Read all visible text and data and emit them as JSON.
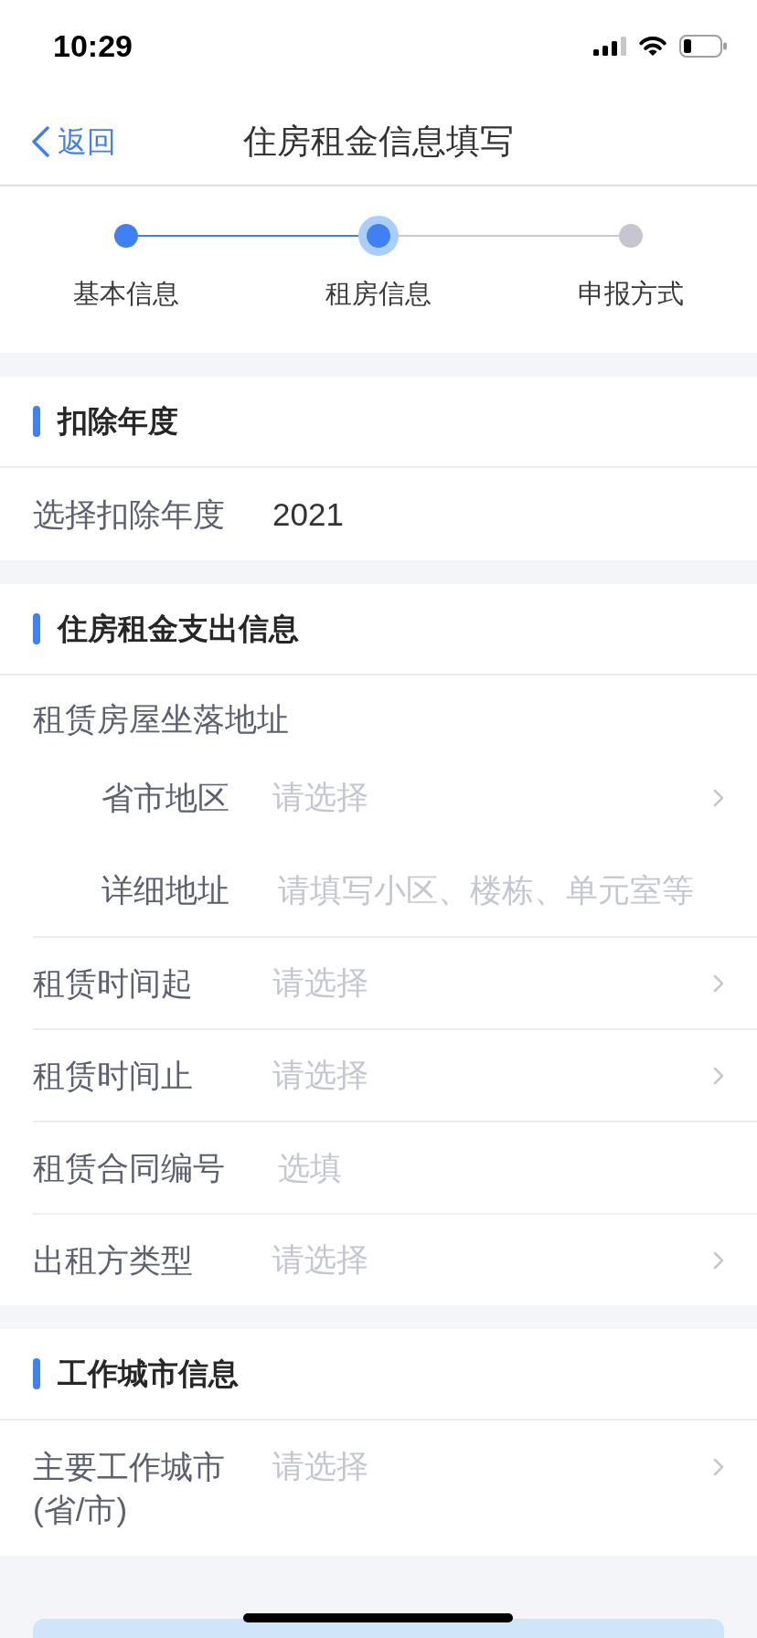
{
  "status_bar": {
    "time": "10:29"
  },
  "nav_bar": {
    "back": "返回",
    "title": "住房租金信息填写"
  },
  "steps": [
    {
      "label": "基本信息",
      "completed": true,
      "selected": false
    },
    {
      "label": "租房信息",
      "completed": false,
      "selected": true
    },
    {
      "label": "申报方式",
      "completed": false,
      "selected": false
    }
  ],
  "sections": [
    {
      "title": "扣除年度",
      "fields": [
        {
          "kind": "value",
          "label": "选择扣除年度",
          "value": "2021"
        }
      ]
    },
    {
      "title": "住房租金支出信息",
      "fields": [
        {
          "kind": "group",
          "label": "租赁房屋坐落地址",
          "children": [
            {
              "kind": "picker",
              "label": "省市地区",
              "placeholder": "请选择"
            },
            {
              "kind": "input",
              "label": "详细地址",
              "placeholder": "请填写小区、楼栋、单元室等"
            }
          ]
        },
        {
          "kind": "picker",
          "label": "租赁时间起",
          "placeholder": "请选择"
        },
        {
          "kind": "picker",
          "label": "租赁时间止",
          "placeholder": "请选择"
        },
        {
          "kind": "input",
          "label": "租赁合同编号",
          "placeholder": "选填"
        },
        {
          "kind": "picker",
          "label": "出租方类型",
          "placeholder": "请选择"
        }
      ]
    },
    {
      "title": "工作城市信息",
      "fields": [
        {
          "kind": "picker",
          "label": "主要工作城市(省/市)",
          "placeholder": "请选择"
        }
      ]
    }
  ]
}
